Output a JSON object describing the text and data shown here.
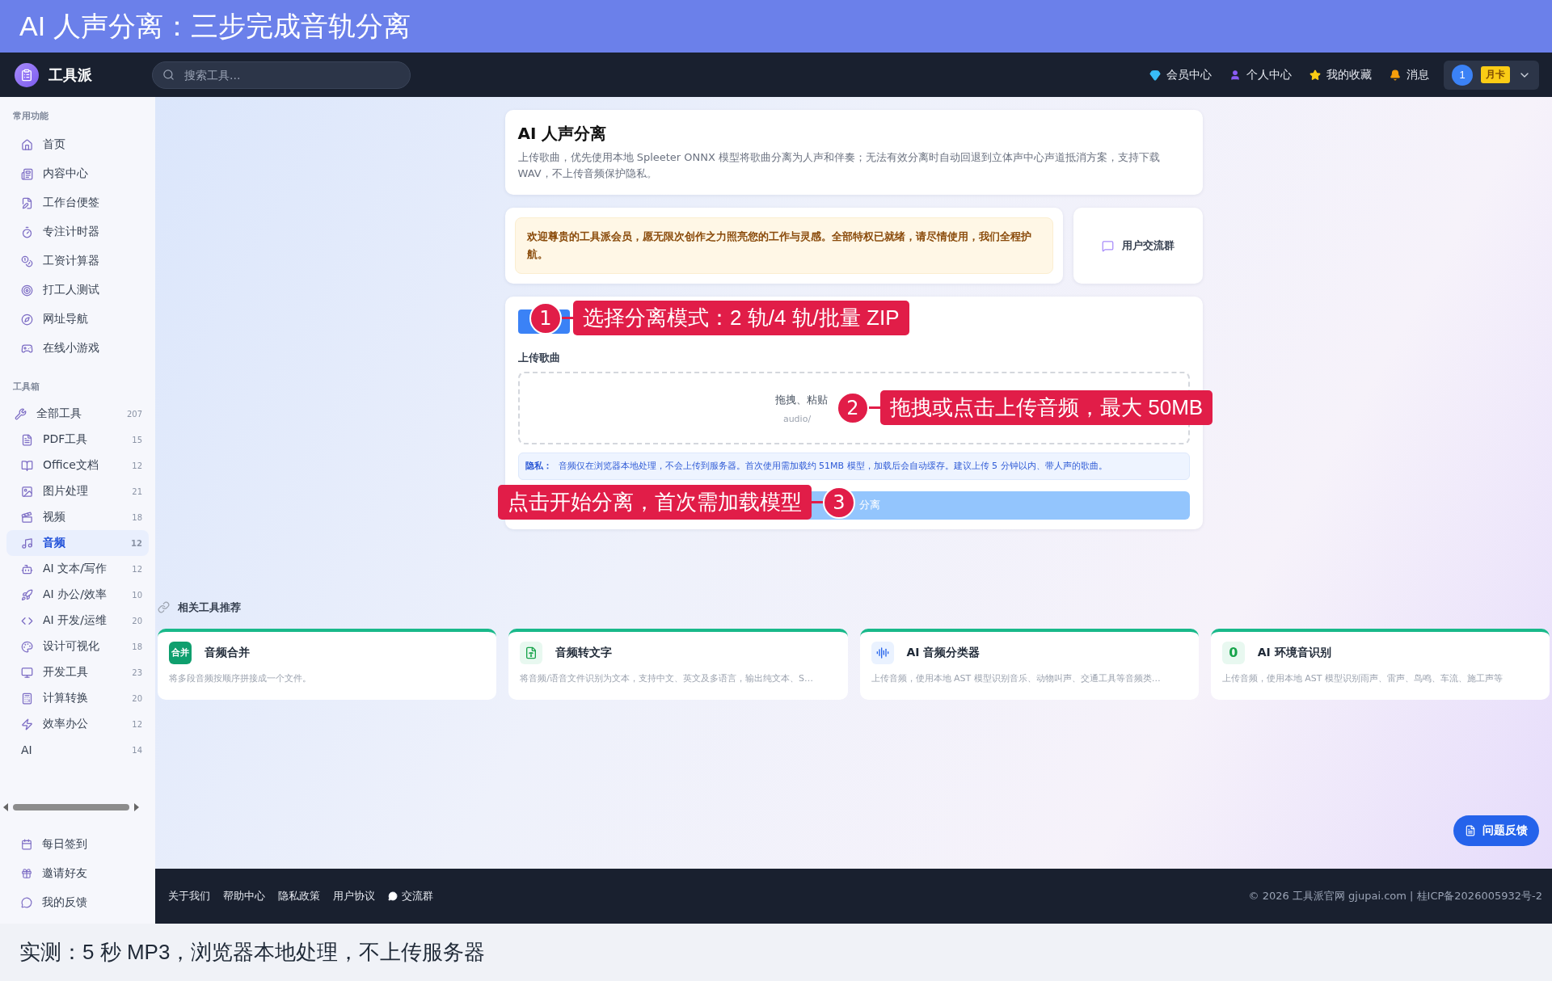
{
  "banner": {
    "title": "AI 人声分离：三步完成音轨分离"
  },
  "header": {
    "logo": "工具派",
    "search": {
      "placeholder": "搜索工具..."
    },
    "nav": [
      {
        "label": "会员中心"
      },
      {
        "label": "个人中心"
      },
      {
        "label": "我的收藏"
      },
      {
        "label": "消息"
      }
    ],
    "user": {
      "avatar": "1",
      "badge": "月卡"
    }
  },
  "sidebar": {
    "sections": [
      {
        "title": "常用功能",
        "items": [
          {
            "label": "首页",
            "selected": false
          },
          {
            "label": "内容中心",
            "selected": false
          },
          {
            "label": "工作台便签",
            "selected": false
          },
          {
            "label": "专注计时器",
            "selected": false
          },
          {
            "label": "工资计算器",
            "selected": false
          },
          {
            "label": "打工人测试",
            "selected": false
          },
          {
            "label": "网址导航",
            "selected": false
          },
          {
            "label": "在线小游戏",
            "selected": false
          }
        ]
      },
      {
        "title": "工具箱",
        "items": [
          {
            "label": "全部工具",
            "count": "207",
            "selected": false,
            "children": [
              {
                "label": "PDF工具",
                "count": "15",
                "selected": false
              },
              {
                "label": "Office文档",
                "count": "12",
                "selected": false
              },
              {
                "label": "图片处理",
                "count": "21",
                "selected": false
              },
              {
                "label": "视频",
                "count": "18",
                "selected": false
              },
              {
                "label": "音频",
                "count": "12",
                "selected": true
              },
              {
                "label": "AI 文本/写作",
                "count": "12",
                "selected": false
              },
              {
                "label": "AI 办公/效率",
                "count": "10",
                "selected": false
              },
              {
                "label": "AI 开发/运维",
                "count": "20",
                "selected": false
              },
              {
                "label": "设计可视化",
                "count": "18",
                "selected": false
              },
              {
                "label": "开发工具",
                "count": "23",
                "selected": false
              },
              {
                "label": "计算转换",
                "count": "20",
                "selected": false
              },
              {
                "label": "效率办公",
                "count": "12",
                "selected": false
              }
            ]
          },
          {
            "label": "AI",
            "count": "14",
            "selected": false
          }
        ]
      }
    ],
    "bottom_items": [
      {
        "label": "每日签到"
      },
      {
        "label": "邀请好友"
      },
      {
        "label": "我的反馈"
      }
    ]
  },
  "tool": {
    "title": "AI 人声分离",
    "description": "上传歌曲，优先使用本地 Spleeter ONNX 模型将歌曲分离为人声和伴奏；无法有效分离时自动回退到立体声中心声道抵消方案，支持下载 WAV，不上传音频保护隐私。"
  },
  "member": {
    "welcome": "欢迎尊贵的工具派会员，愿无限次创作之力照亮您的工作与灵感。全部特权已就绪，请尽情使用，我们全程护航。",
    "group_button": "用户交流群"
  },
  "separator": {
    "upload_label": "上传歌曲",
    "drop_text": "拖拽、粘贴",
    "drop_hint": "audio/",
    "privacy_label": "隐私：",
    "privacy_text": "音频仅在浏览器本地处理，不会上传到服务器。首次使用需加载约 51MB 模型，加载后会自动缓存。建议上传 5 分钟以内、带人声的歌曲。",
    "start_button": {
      "label": "分离",
      "disabled": true
    }
  },
  "related": {
    "title": "相关工具推荐",
    "cards": [
      {
        "icon_text": "合并",
        "title": "音频合并",
        "description": "将多段音频按顺序拼接成一个文件。"
      },
      {
        "title": "音频转文字",
        "description": "将音频/语音文件识别为文本，支持中文、英文及多语言，输出纯文本、S…"
      },
      {
        "title": "AI 音频分类器",
        "description": "上传音频，使用本地 AST 模型识别音乐、动物叫声、交通工具等音频类…"
      },
      {
        "icon_text": "0",
        "title": "AI 环境音识别",
        "description": "上传音频，使用本地 AST 模型识别雨声、雷声、鸟鸣、车流、施工声等"
      }
    ]
  },
  "feedback_button": "问题反馈",
  "footer": {
    "links": [
      {
        "label": "关于我们"
      },
      {
        "label": "帮助中心"
      },
      {
        "label": "隐私政策"
      },
      {
        "label": "用户协议"
      },
      {
        "label": "交流群"
      }
    ],
    "copyright": "© 2026 工具派官网 gjupai.com | 桂ICP备2026005932号-2"
  },
  "annotations": [
    {
      "number": "1",
      "text": "选择分离模式：2 轨/4 轨/批量 ZIP"
    },
    {
      "number": "2",
      "text": "拖拽或点击上传音频，最大 50MB"
    },
    {
      "number": "3",
      "text": "点击开始分离，首次需加载模型"
    }
  ],
  "caption": "实测：5 秒 MP3，浏览器本地处理，不上传服务器"
}
